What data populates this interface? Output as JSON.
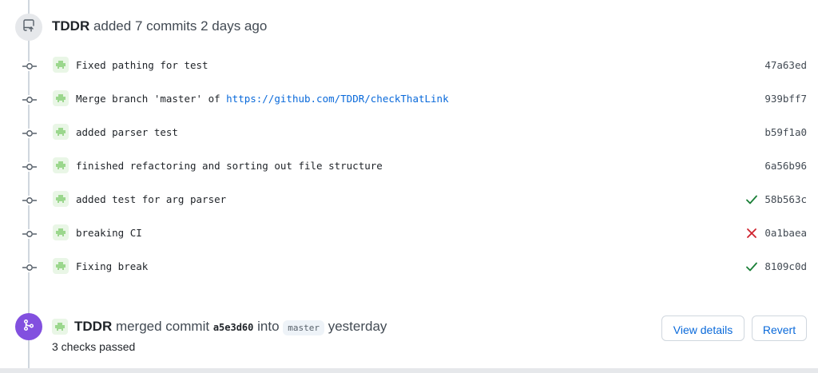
{
  "push_event": {
    "author": "TDDR",
    "text": " added 7 commits 2 days ago",
    "icon": "repo-push-icon"
  },
  "commits": [
    {
      "message": "Fixed pathing for test",
      "sha": "47a63ed",
      "status": "none"
    },
    {
      "message_prefix": "Merge branch 'master' of ",
      "message_link": "https://github.com/TDDR/checkThatLink",
      "sha": "939bff7",
      "status": "none"
    },
    {
      "message": "added parser test",
      "sha": "b59f1a0",
      "status": "none"
    },
    {
      "message": "finished refactoring and sorting out file structure",
      "sha": "6a56b96",
      "status": "none"
    },
    {
      "message": "added test for arg parser",
      "sha": "58b563c",
      "status": "success"
    },
    {
      "message": "breaking CI",
      "sha": "0a1baea",
      "status": "failure"
    },
    {
      "message": "Fixing break",
      "sha": "8109c0d",
      "status": "success"
    }
  ],
  "merge_event": {
    "author": "TDDR",
    "verb": " merged commit ",
    "sha": "a5e3d60",
    "into": " into ",
    "branch": "master",
    "time": " yesterday",
    "checks": "3 checks passed",
    "view_details_label": "View details",
    "revert_label": "Revert",
    "icon": "git-merge-icon"
  },
  "colors": {
    "success": "#1a7f37",
    "failure": "#cf222e",
    "merge_purple": "#8250df",
    "link": "#0969da"
  }
}
